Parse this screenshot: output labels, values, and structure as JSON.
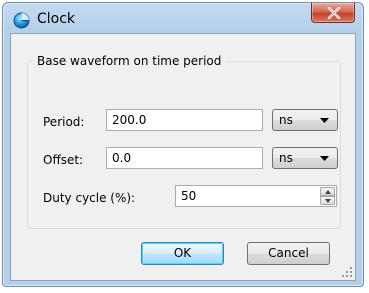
{
  "window": {
    "title": "Clock",
    "close_glyph": "X"
  },
  "group": {
    "title": "Base waveform on time period"
  },
  "period": {
    "label": "Period:",
    "value": "200.0",
    "unit": "ns"
  },
  "offset": {
    "label": "Offset:",
    "value": "0.0",
    "unit": "ns"
  },
  "duty": {
    "label": "Duty cycle (%):",
    "value": "50"
  },
  "buttons": {
    "ok": "OK",
    "cancel": "Cancel"
  },
  "icons": {
    "app": "clock-app-icon",
    "close": "close-icon",
    "dropdown": "chevron-down-icon",
    "spin_up": "spin-up-icon",
    "spin_down": "spin-down-icon",
    "grip": "resize-grip-icon"
  },
  "colors": {
    "title_bar": "#b9d1ea",
    "close_button": "#c7432c",
    "client_bg": "#f0f0f0",
    "default_button_border": "#3c7fb1"
  }
}
